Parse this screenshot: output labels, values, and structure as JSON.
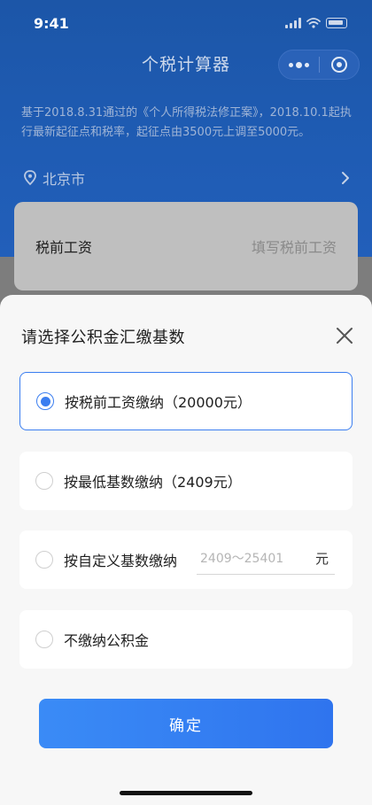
{
  "status_bar": {
    "time": "9:41"
  },
  "nav": {
    "title": "个税计算器"
  },
  "intro": {
    "text": "基于2018.8.31通过的《个人所得税法修正案》，2018.10.1起执行最新起征点和税率，起征点由3500元上调至5000元。"
  },
  "location": {
    "city": "北京市"
  },
  "salary": {
    "label": "税前工资",
    "placeholder": "填写税前工资"
  },
  "sheet": {
    "title": "请选择公积金汇缴基数",
    "options": [
      {
        "label": "按税前工资缴纳（20000元）",
        "selected": true
      },
      {
        "label": "按最低基数缴纳（2409元）",
        "selected": false
      },
      {
        "label": "按自定义基数缴纳",
        "selected": false,
        "input_placeholder": "2409～25401",
        "unit": "元"
      },
      {
        "label": "不缴纳公积金",
        "selected": false
      }
    ],
    "confirm_label": "确定"
  },
  "colors": {
    "accent": "#3b7ef0",
    "header_blue": "#1f5cb4"
  }
}
